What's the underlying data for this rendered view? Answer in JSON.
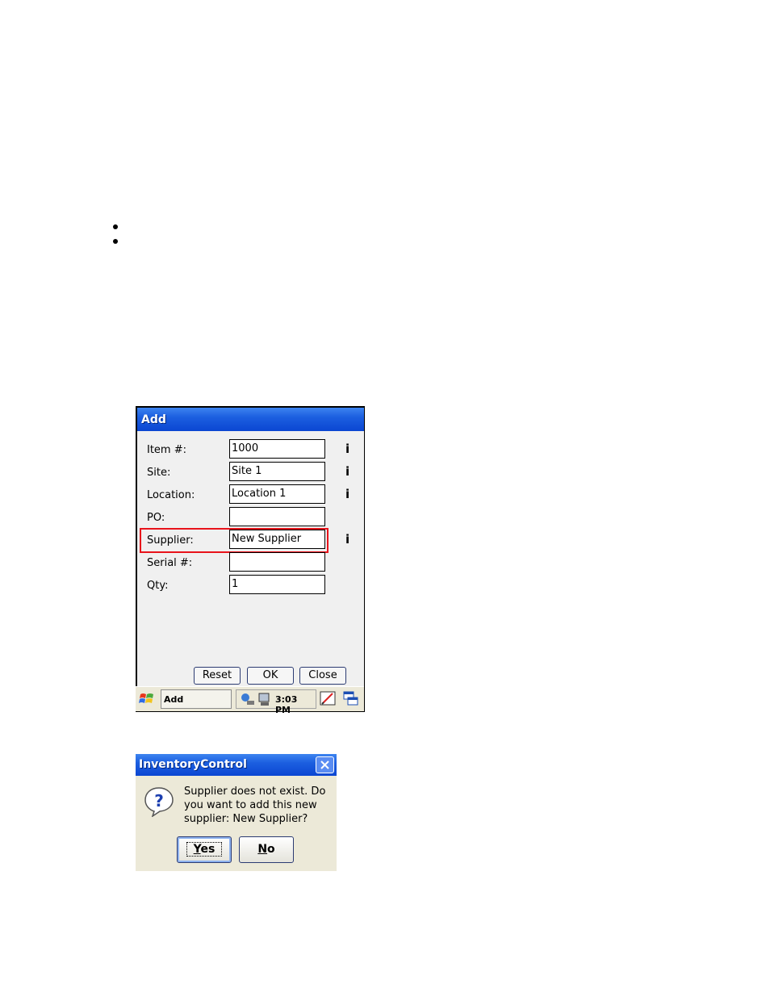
{
  "add_window": {
    "title": "Add",
    "fields": [
      {
        "label": "Item #:",
        "value": "1000",
        "info": "i"
      },
      {
        "label": "Site:",
        "value": "Site 1",
        "info": "i"
      },
      {
        "label": "Location:",
        "value": "Location 1",
        "info": "i"
      },
      {
        "label": "PO:",
        "value": "",
        "info": ""
      },
      {
        "label": "Supplier:",
        "value": "New Supplier",
        "info": "i"
      },
      {
        "label": "Serial #:",
        "value": "",
        "info": ""
      },
      {
        "label": "Qty:",
        "value": "1",
        "info": ""
      }
    ],
    "buttons": {
      "reset": "Reset",
      "ok": "OK",
      "close": "Close"
    },
    "highlight_color": "#e8131b"
  },
  "taskbar": {
    "task_label": "Add",
    "clock": "3:03 PM"
  },
  "message_box": {
    "title": "InventoryControl",
    "text": "Supplier does not exist. Do you want to add this new supplier: New Supplier?",
    "yes_label_first": "Y",
    "yes_label_rest": "es",
    "no_label_first": "N",
    "no_label_rest": "o"
  },
  "colors": {
    "titlebar": "#0b46d2",
    "dialog_bg": "#ece9d8",
    "window_bg": "#f0f0f0"
  }
}
